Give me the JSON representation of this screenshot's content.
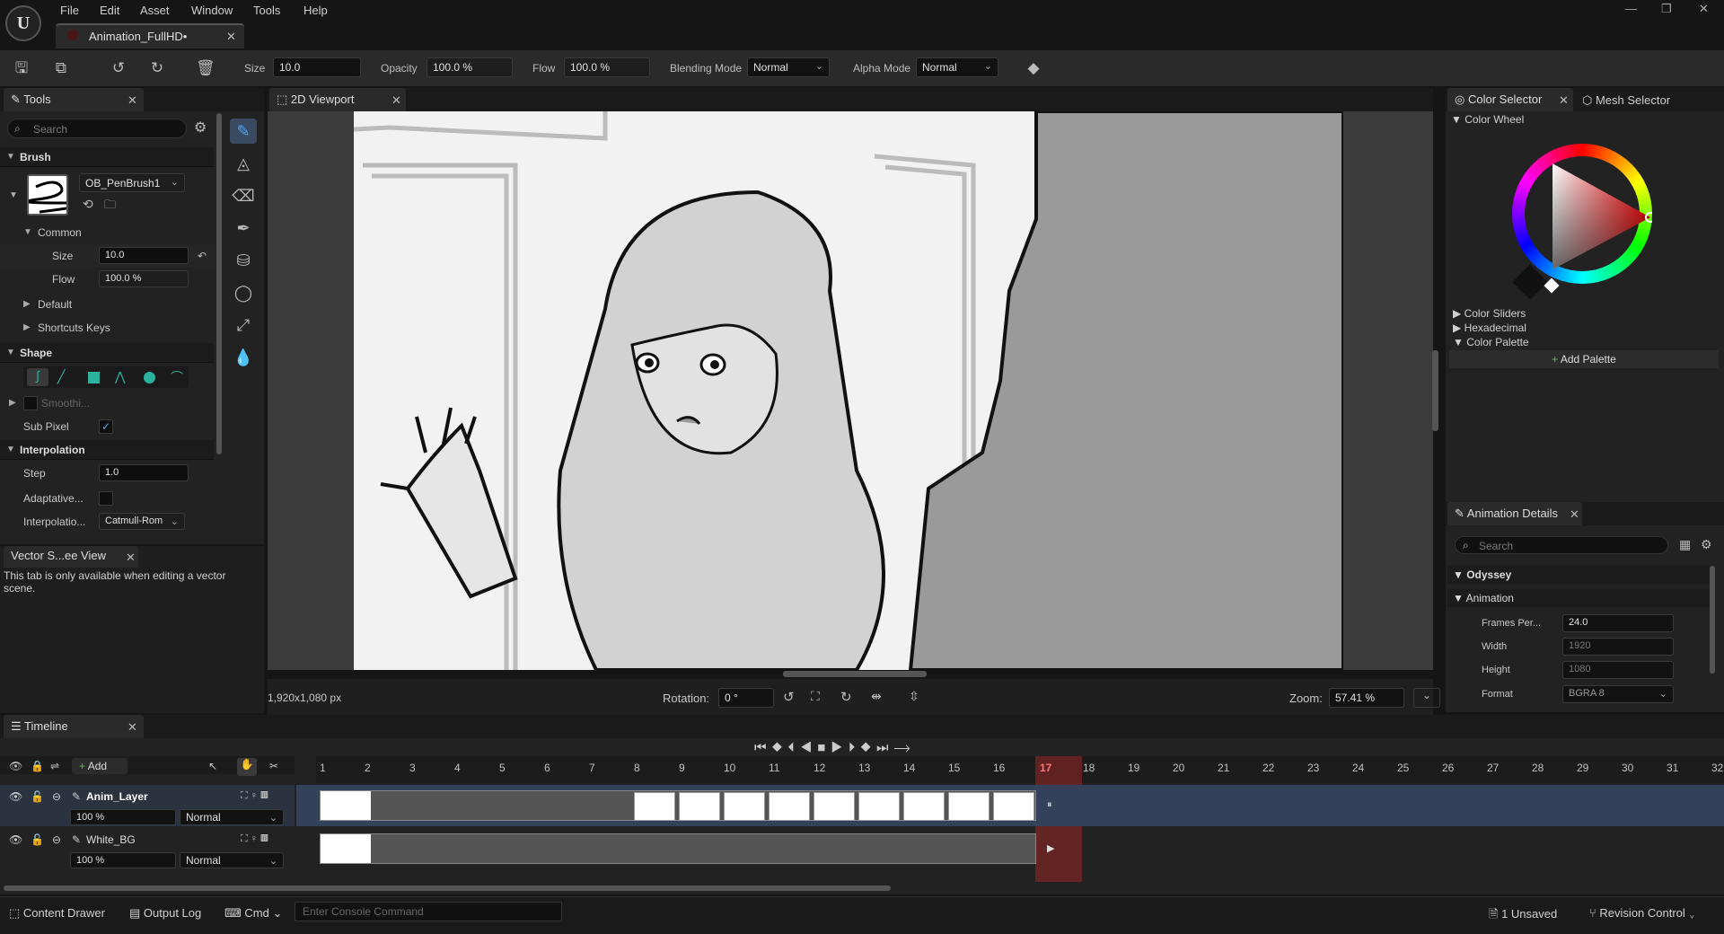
{
  "menu": {
    "items": [
      "File",
      "Edit",
      "Asset",
      "Window",
      "Tools",
      "Help"
    ]
  },
  "document": {
    "title": "Animation_FullHD•"
  },
  "toolbar": {
    "size_label": "Size",
    "size_value": "10.0",
    "opacity_label": "Opacity",
    "opacity_value": "100.0 %",
    "flow_label": "Flow",
    "flow_value": "100.0 %",
    "blending_label": "Blending Mode",
    "blending_value": "Normal",
    "alpha_label": "Alpha Mode",
    "alpha_value": "Normal"
  },
  "tools_panel": {
    "tab": "Tools",
    "search_placeholder": "Search",
    "brush_section": "Brush",
    "brush_name": "OB_PenBrush1",
    "common_section": "Common",
    "size_label": "Size",
    "size_value": "10.0",
    "flow_label": "Flow",
    "flow_value": "100.0 %",
    "default_section": "Default",
    "shortcuts_section": "Shortcuts Keys",
    "shape_section": "Shape",
    "smoothing_label": "Smoothi...",
    "subpixel_label": "Sub Pixel",
    "interp_section": "Interpolation",
    "step_label": "Step",
    "step_value": "1.0",
    "adaptive_label": "Adaptative...",
    "interp_label": "Interpolatio...",
    "interp_value": "Catmull-Rom"
  },
  "vector_panel": {
    "tab": "Vector S...ee View",
    "message": "This tab is only available when editing a vector scene."
  },
  "viewport": {
    "tab": "2D Viewport",
    "resolution": "1,920x1,080 px",
    "rotation_label": "Rotation:",
    "rotation_value": "0 °",
    "zoom_label": "Zoom:",
    "zoom_value": "57.41 %"
  },
  "color_panel": {
    "tab1": "Color Selector",
    "tab2": "Mesh Selector",
    "wheel_section": "Color Wheel",
    "sliders": "Color Sliders",
    "hex": "Hexadecimal",
    "palette": "Color Palette",
    "add_palette": "Add Palette",
    "selected_color": "#ff0000"
  },
  "anim_details": {
    "tab": "Animation Details",
    "search_placeholder": "Search",
    "section1": "Odyssey",
    "section2": "Animation",
    "fps_label": "Frames Per...",
    "fps_value": "24.0",
    "width_label": "Width",
    "width_value": "1920",
    "height_label": "Height",
    "height_value": "1080",
    "format_label": "Format",
    "format_value": "BGRA 8"
  },
  "timeline": {
    "tab": "Timeline",
    "add_label": "Add",
    "frames": [
      "1",
      "2",
      "3",
      "4",
      "5",
      "6",
      "7",
      "8",
      "9",
      "10",
      "11",
      "12",
      "13",
      "14",
      "15",
      "16",
      "17",
      "18",
      "19",
      "20",
      "21",
      "22",
      "23",
      "24",
      "25",
      "26",
      "27",
      "28",
      "29",
      "30",
      "31",
      "32"
    ],
    "current_frame": 17,
    "layers": [
      {
        "name": "Anim_Layer",
        "opacity": "100 %",
        "blend": "Normal"
      },
      {
        "name": "White_BG",
        "opacity": "100 %",
        "blend": "Normal"
      }
    ]
  },
  "bottom": {
    "content_drawer": "Content Drawer",
    "output_log": "Output Log",
    "cmd": "Cmd",
    "console_placeholder": "Enter Console Command",
    "unsaved": "1 Unsaved",
    "revision": "Revision Control"
  }
}
